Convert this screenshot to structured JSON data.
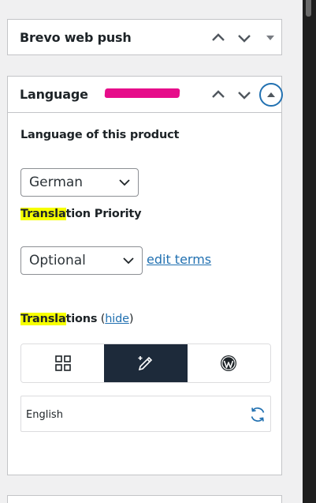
{
  "colors": {
    "accent": "#2271b1",
    "highlight": "#f6ff00",
    "redaction": "#e60d8a",
    "active_tab": "#1d2a3a"
  },
  "panels": {
    "brevo": {
      "title": "Brevo web push",
      "controls": [
        "chevron-up-icon",
        "chevron-down-icon",
        "caret-down-icon"
      ]
    },
    "language": {
      "title": "Language",
      "controls": [
        "chevron-up-icon",
        "chevron-down-icon",
        "caret-up-icon"
      ],
      "language_label": "Language of this product",
      "language_value": "German",
      "priority_label_highlight": "Transla",
      "priority_label_rest": "tion Priority",
      "priority_value": "Optional",
      "edit_terms": "edit terms",
      "translations_label_highlight": "Transla",
      "translations_label_rest": "tions",
      "hide_open": "(",
      "hide_link": "hide",
      "hide_close": ")",
      "tabs": [
        {
          "icon": "grid-icon",
          "active": false
        },
        {
          "icon": "pen-sparkle-icon",
          "active": true
        },
        {
          "icon": "wordpress-icon",
          "active": false
        }
      ],
      "translation_rows": [
        {
          "language": "English",
          "action_icon": "sync-icon"
        }
      ]
    }
  }
}
